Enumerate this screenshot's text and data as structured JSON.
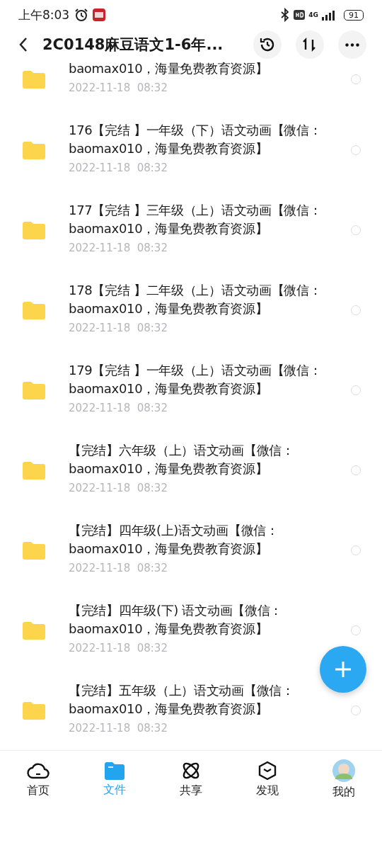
{
  "status_bar": {
    "time": "上午8:03",
    "network": "4G",
    "battery": "91"
  },
  "header": {
    "title": "2C0148麻豆语文1-6年..."
  },
  "files": [
    {
      "name_lines": [
        "baomax010，海量免费教育资源】"
      ],
      "date": "2022-11-18  08:32",
      "selected": false
    },
    {
      "name_lines": [
        "176【完结 】一年级（下）语文动画【微信：",
        "baomax010，海量免费教育资源】"
      ],
      "date": "2022-11-18  08:32",
      "selected": false
    },
    {
      "name_lines": [
        "177【完结 】三年级（上）语文动画【微信：",
        "baomax010，海量免费教育资源】"
      ],
      "date": "2022-11-18  08:32",
      "selected": false
    },
    {
      "name_lines": [
        "178【完结 】二年级（上）语文动画【微信：",
        "baomax010，海量免费教育资源】"
      ],
      "date": "2022-11-18  08:32",
      "selected": false
    },
    {
      "name_lines": [
        "179【完结 】一年级（上）语文动画【微信：",
        "baomax010，海量免费教育资源】"
      ],
      "date": "2022-11-18  08:32",
      "selected": false
    },
    {
      "name_lines": [
        "【完结】六年级（上）语文动画【微信：",
        "baomax010，海量免费教育资源】"
      ],
      "date": "2022-11-18  08:32",
      "selected": false
    },
    {
      "name_lines": [
        "【完结】四年级(上)语文动画【微信：",
        "baomax010，海量免费教育资源】"
      ],
      "date": "2022-11-18  08:32",
      "selected": false
    },
    {
      "name_lines": [
        "【完结】四年级(下) 语文动画【微信：",
        "baomax010，海量免费教育资源】"
      ],
      "date": "2022-11-18  08:32",
      "selected": false
    },
    {
      "name_lines": [
        "【完结】五年级（上）语文动画【微信：",
        "baomax010，海量免费教育资源】"
      ],
      "date": "2022-11-18  08:32",
      "selected": false
    }
  ],
  "nav": [
    {
      "kind": "home",
      "label": "首页",
      "selected": false
    },
    {
      "kind": "files",
      "label": "文件",
      "selected": true
    },
    {
      "kind": "share",
      "label": "共享",
      "selected": false
    },
    {
      "kind": "discover",
      "label": "发现",
      "selected": false
    },
    {
      "kind": "me",
      "label": "我的",
      "selected": false
    }
  ]
}
